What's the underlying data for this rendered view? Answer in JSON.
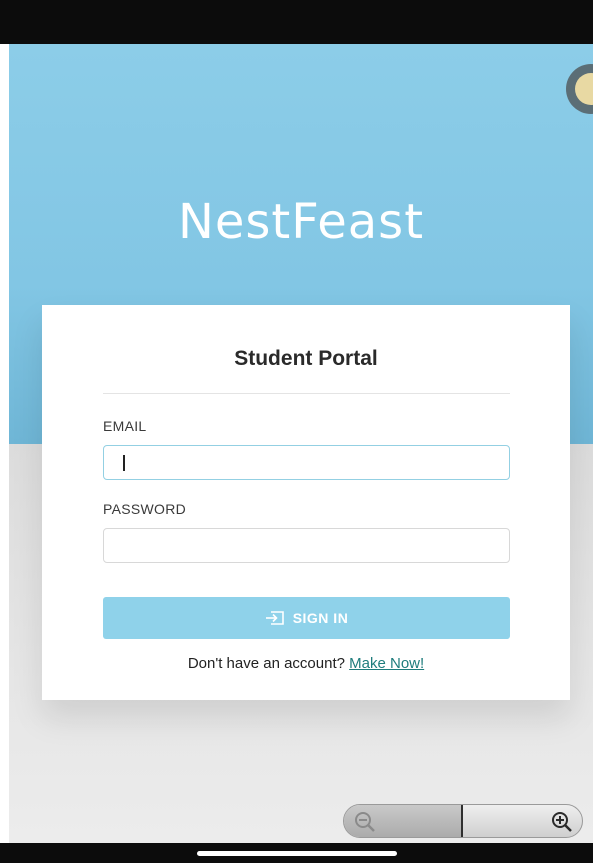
{
  "app": {
    "title": "NestFeast"
  },
  "login_card": {
    "heading": "Student Portal",
    "email_label": "EMAIL",
    "email_value": "",
    "password_label": "PASSWORD",
    "password_value": "",
    "sign_in_label": "SIGN IN",
    "sign_in_icon": "sign-in-icon",
    "signup_prompt": "Don't have an account?",
    "signup_link": "Make Now!"
  },
  "zoom_control": {
    "zoom_out_icon": "zoom-out-icon",
    "zoom_in_icon": "zoom-in-icon"
  },
  "colors": {
    "hero_blue": "#8ccde8",
    "button_blue": "#8fd2ea",
    "link_teal": "#1e7c7c",
    "input_focus_border": "#93d0e3"
  }
}
